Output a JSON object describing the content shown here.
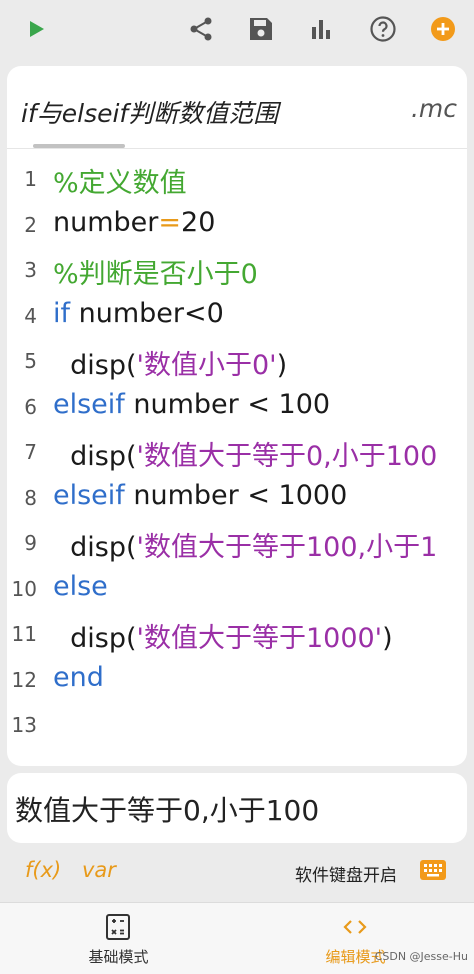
{
  "toolbar": {
    "icons": [
      "play-icon",
      "share-icon",
      "save-icon",
      "bar-chart-icon",
      "help-icon",
      "add-icon"
    ],
    "accent": "#f29a1a",
    "play_color": "#3aa64c"
  },
  "editor": {
    "file_name": "if与elseif判断数值范围",
    "file_ext": ".mc",
    "lines": [
      {
        "num": "1",
        "segments": [
          {
            "t": "%定义数值",
            "c": "cmt"
          }
        ]
      },
      {
        "num": "2",
        "segments": [
          {
            "t": "number",
            "c": ""
          },
          {
            "t": "=",
            "c": "op"
          },
          {
            "t": "20",
            "c": ""
          }
        ]
      },
      {
        "num": "3",
        "segments": [
          {
            "t": "%判断是否小于0",
            "c": "cmt"
          }
        ]
      },
      {
        "num": "4",
        "segments": [
          {
            "t": "if",
            "c": "kw"
          },
          {
            "t": " number<0",
            "c": ""
          }
        ]
      },
      {
        "num": "5",
        "segments": [
          {
            "t": "  disp(",
            "c": ""
          },
          {
            "t": "'数值小于0'",
            "c": "str"
          },
          {
            "t": ")",
            "c": ""
          }
        ]
      },
      {
        "num": "6",
        "segments": [
          {
            "t": "elseif",
            "c": "kw"
          },
          {
            "t": " number < 100",
            "c": ""
          }
        ]
      },
      {
        "num": "7",
        "segments": [
          {
            "t": "  disp(",
            "c": ""
          },
          {
            "t": "'数值大于等于0,小于100",
            "c": "str"
          }
        ]
      },
      {
        "num": "8",
        "segments": [
          {
            "t": "elseif",
            "c": "kw"
          },
          {
            "t": " number < 1000",
            "c": ""
          }
        ]
      },
      {
        "num": "9",
        "segments": [
          {
            "t": "  disp(",
            "c": ""
          },
          {
            "t": "'数值大于等于100,小于1",
            "c": "str"
          }
        ]
      },
      {
        "num": "10",
        "segments": [
          {
            "t": "else",
            "c": "kw"
          }
        ]
      },
      {
        "num": "11",
        "segments": [
          {
            "t": "  disp(",
            "c": ""
          },
          {
            "t": "'数值大于等于1000'",
            "c": "str"
          },
          {
            "t": ")",
            "c": ""
          }
        ]
      },
      {
        "num": "12",
        "segments": [
          {
            "t": "end",
            "c": "kw"
          }
        ]
      },
      {
        "num": "13",
        "segments": []
      }
    ]
  },
  "output": {
    "text": "数值大于等于0,小于100"
  },
  "quickbar": {
    "fx_label": "f(x)",
    "var_label": "var",
    "keyboard_label": "软件键盘开启"
  },
  "bottom_nav": {
    "basic_label": "基础模式",
    "edit_label": "编辑模式"
  },
  "watermark": "CSDN @Jesse-Hu",
  "colors": {
    "comment": "#44a832",
    "keyword": "#2f6eca",
    "string": "#9a2fa6",
    "operator": "#e89a1a",
    "active_tab": "#e89a1a"
  }
}
